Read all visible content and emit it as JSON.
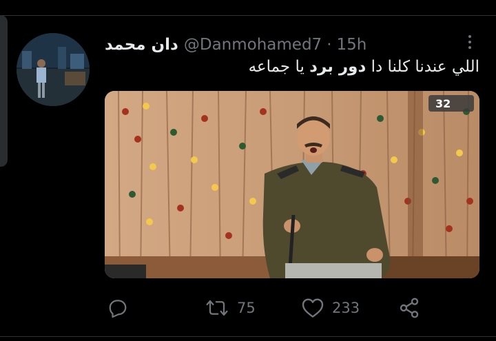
{
  "tweet": {
    "author_name": "دان محمد",
    "handle": "@Danmohamed7",
    "separator": "·",
    "time": "15h",
    "text_before": "اللي عندنا كلنا دا ",
    "text_bold": "دور برد",
    "text_after": " يا جماعه"
  },
  "media": {
    "channel_logo": "32",
    "description_icon": "video-still"
  },
  "actions": {
    "reply": {
      "icon": "reply-icon",
      "count": ""
    },
    "retweet": {
      "icon": "retweet-icon",
      "count": "75"
    },
    "like": {
      "icon": "heart-icon",
      "count": "233"
    },
    "share": {
      "icon": "share-icon"
    }
  },
  "colors": {
    "background": "#000000",
    "text_primary": "#e7e9ea",
    "text_secondary": "#71767b",
    "divider": "#2f3336"
  }
}
